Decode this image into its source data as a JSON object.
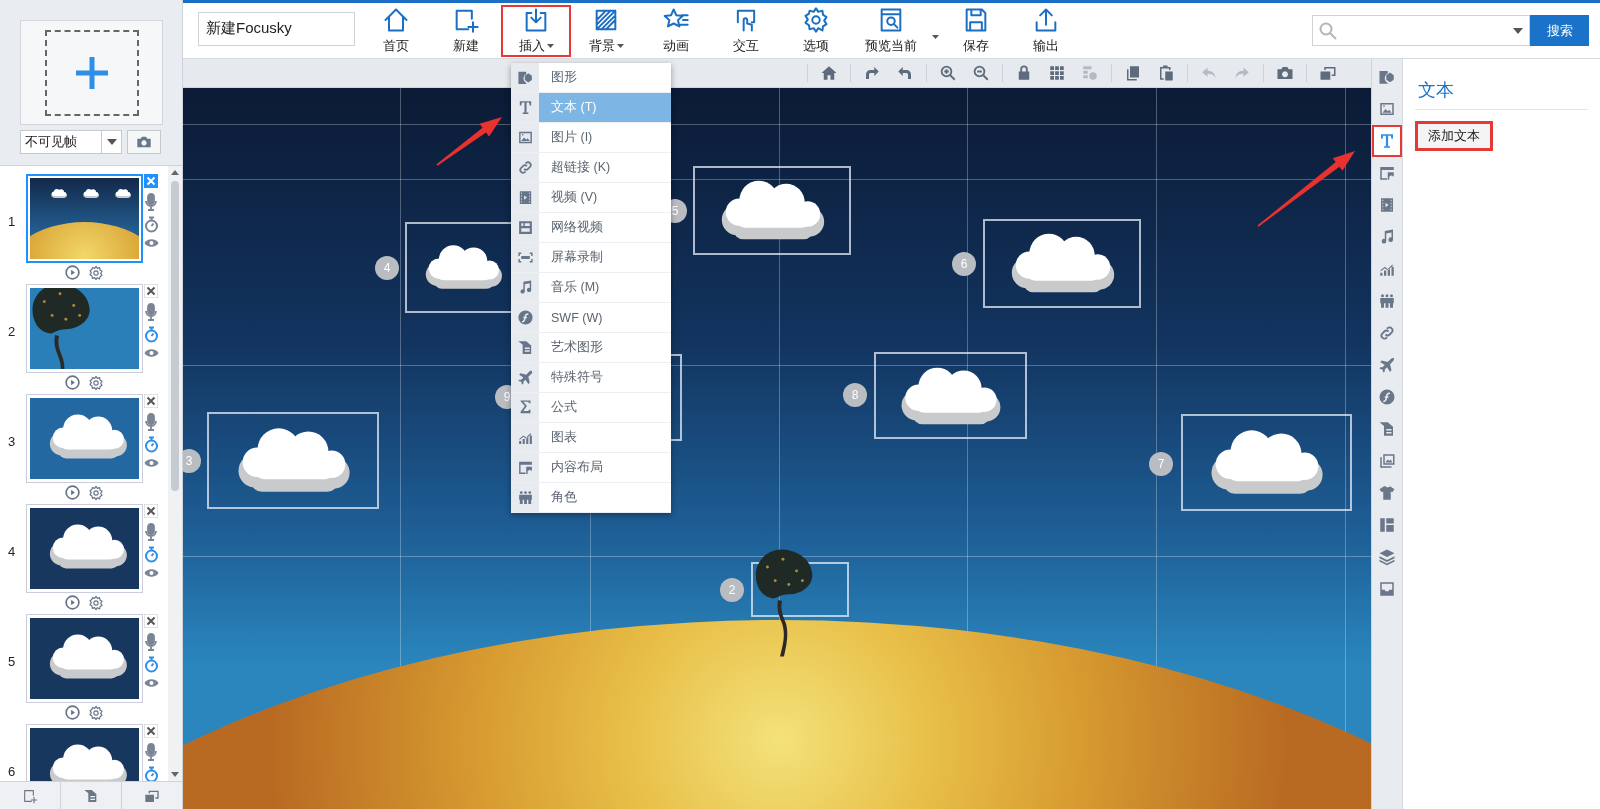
{
  "left_panel": {
    "frame_filter": "不可见帧"
  },
  "slides": [
    {
      "number": "1",
      "selected": true,
      "timer_on": false,
      "kind": "planet"
    },
    {
      "number": "2",
      "selected": false,
      "timer_on": true,
      "kind": "tree"
    },
    {
      "number": "3",
      "selected": false,
      "timer_on": true,
      "kind": "cloud"
    },
    {
      "number": "4",
      "selected": false,
      "timer_on": true,
      "kind": "nightcloud"
    },
    {
      "number": "5",
      "selected": false,
      "timer_on": true,
      "kind": "nightcloud"
    },
    {
      "number": "6",
      "selected": false,
      "timer_on": true,
      "kind": "nightcloud"
    }
  ],
  "doc_title": "新建Focusky",
  "toolbar": [
    {
      "kind": "home",
      "label": "首页",
      "dropdown": false,
      "split": false,
      "highlighted": false
    },
    {
      "kind": "new",
      "label": "新建",
      "dropdown": false,
      "split": false,
      "highlighted": false
    },
    {
      "kind": "insert",
      "label": "插入",
      "dropdown": true,
      "split": false,
      "highlighted": true
    },
    {
      "kind": "background",
      "label": "背景",
      "dropdown": true,
      "split": false,
      "highlighted": false
    },
    {
      "kind": "animation",
      "label": "动画",
      "dropdown": false,
      "split": false,
      "highlighted": false
    },
    {
      "kind": "interaction",
      "label": "交互",
      "dropdown": false,
      "split": false,
      "highlighted": false
    },
    {
      "kind": "options",
      "label": "选项",
      "dropdown": false,
      "split": false,
      "highlighted": false
    },
    {
      "kind": "preview",
      "label": "预览当前",
      "dropdown": true,
      "split": true,
      "highlighted": false
    },
    {
      "kind": "save",
      "label": "保存",
      "dropdown": false,
      "split": false,
      "highlighted": false
    },
    {
      "kind": "export",
      "label": "输出",
      "dropdown": false,
      "split": false,
      "highlighted": false
    }
  ],
  "search_button": "搜索",
  "canvas_toolbar": [
    {
      "tools": [
        {
          "kind": "home",
          "disabled": false
        }
      ]
    },
    {
      "tools": [
        {
          "kind": "rotateright",
          "disabled": false
        },
        {
          "kind": "rotateleft",
          "disabled": false
        }
      ]
    },
    {
      "tools": [
        {
          "kind": "zoomin",
          "disabled": false
        },
        {
          "kind": "zoomout",
          "disabled": false
        }
      ]
    },
    {
      "tools": [
        {
          "kind": "lock",
          "disabled": false
        },
        {
          "kind": "grid",
          "disabled": false
        },
        {
          "kind": "config",
          "disabled": true
        }
      ]
    },
    {
      "tools": [
        {
          "kind": "copy",
          "disabled": false
        },
        {
          "kind": "paste",
          "disabled": false
        }
      ]
    },
    {
      "tools": [
        {
          "kind": "undo",
          "disabled": true
        },
        {
          "kind": "redo",
          "disabled": true
        }
      ]
    },
    {
      "tools": [
        {
          "kind": "camera",
          "disabled": false
        }
      ]
    },
    {
      "tools": [
        {
          "kind": "window",
          "disabled": false
        }
      ]
    }
  ],
  "frames": [
    {
      "number": "4",
      "kind": "cloud"
    },
    {
      "number": "5",
      "kind": "cloud"
    },
    {
      "number": "6",
      "kind": "cloud"
    },
    {
      "number": "9",
      "kind": "cloud"
    },
    {
      "number": "8",
      "kind": "cloud"
    },
    {
      "number": "3",
      "kind": "cloud"
    },
    {
      "number": "7",
      "kind": "cloud"
    },
    {
      "number": "2",
      "kind": "tree"
    }
  ],
  "insert_menu": [
    {
      "kind": "shape",
      "label": "图形",
      "selected": false,
      "highlighted": false
    },
    {
      "kind": "text",
      "label": "文本 (T)",
      "selected": true,
      "highlighted": true
    },
    {
      "kind": "image",
      "label": "图片 (I)",
      "selected": false,
      "highlighted": false
    },
    {
      "kind": "link",
      "label": "超链接 (K)",
      "selected": false,
      "highlighted": false
    },
    {
      "kind": "video",
      "label": "视频 (V)",
      "selected": false,
      "highlighted": false
    },
    {
      "kind": "webvideo",
      "label": "网络视频",
      "selected": false,
      "highlighted": false
    },
    {
      "kind": "record",
      "label": "屏幕录制",
      "selected": false,
      "highlighted": false
    },
    {
      "kind": "music",
      "label": "音乐 (M)",
      "selected": false,
      "highlighted": false
    },
    {
      "kind": "swf",
      "label": "SWF (W)",
      "selected": false,
      "highlighted": false
    },
    {
      "kind": "art",
      "label": "艺术图形",
      "selected": false,
      "highlighted": false
    },
    {
      "kind": "symbol",
      "label": "特殊符号",
      "selected": false,
      "highlighted": false
    },
    {
      "kind": "formula",
      "label": "公式",
      "selected": false,
      "highlighted": false
    },
    {
      "kind": "chart",
      "label": "图表",
      "selected": false,
      "highlighted": false
    },
    {
      "kind": "layout",
      "label": "内容布局",
      "selected": false,
      "highlighted": false
    },
    {
      "kind": "role",
      "label": "角色",
      "selected": false,
      "highlighted": false
    }
  ],
  "side_tools": [
    {
      "kind": "shape",
      "selected": false,
      "highlighted": false
    },
    {
      "kind": "image",
      "selected": false,
      "highlighted": false
    },
    {
      "kind": "text",
      "selected": true,
      "highlighted": true
    },
    {
      "kind": "layout",
      "selected": false,
      "highlighted": false
    },
    {
      "kind": "video",
      "selected": false,
      "highlighted": false
    },
    {
      "kind": "music",
      "selected": false,
      "highlighted": false
    },
    {
      "kind": "chart",
      "selected": false,
      "highlighted": false
    },
    {
      "kind": "role",
      "selected": false,
      "highlighted": false
    },
    {
      "kind": "link",
      "selected": false,
      "highlighted": false
    },
    {
      "kind": "symbol",
      "selected": false,
      "highlighted": false
    },
    {
      "kind": "swf",
      "selected": false,
      "highlighted": false
    },
    {
      "kind": "art",
      "selected": false,
      "highlighted": false
    },
    {
      "kind": "gallery",
      "selected": false,
      "highlighted": false
    },
    {
      "kind": "shirt",
      "selected": false,
      "highlighted": false
    },
    {
      "kind": "panels",
      "selected": false,
      "highlighted": false
    },
    {
      "kind": "layers",
      "selected": false,
      "highlighted": false
    },
    {
      "kind": "tray",
      "selected": false,
      "highlighted": false
    }
  ],
  "panel": {
    "title": "文本",
    "button": "添加文本",
    "button_highlighted": true
  }
}
